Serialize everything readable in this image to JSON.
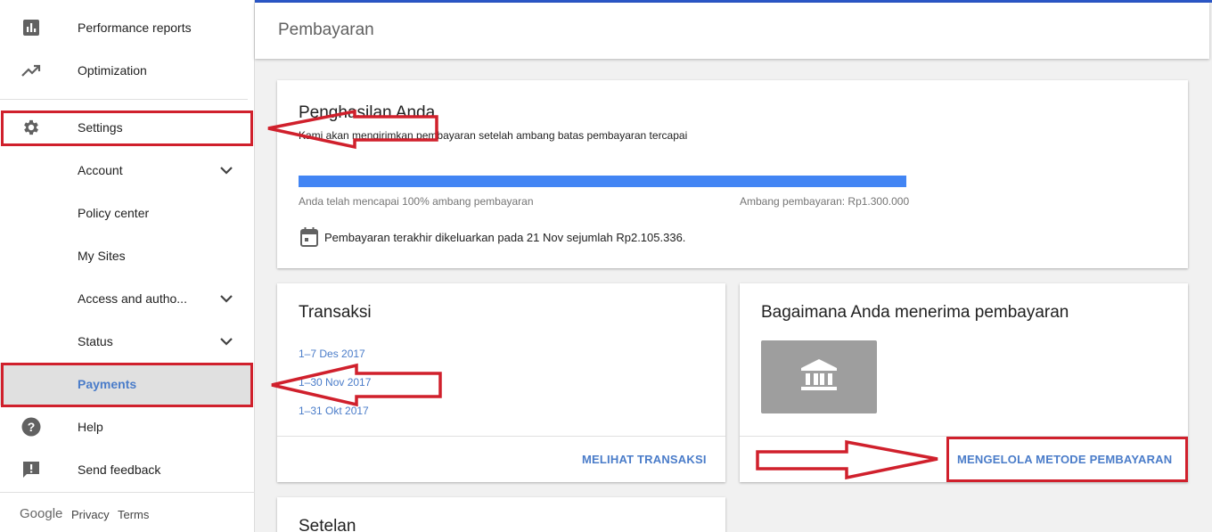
{
  "sidebar": {
    "items": [
      {
        "label": "Performance reports",
        "icon": "bar-chart-icon"
      },
      {
        "label": "Optimization",
        "icon": "trending-up-icon"
      },
      {
        "label": "Settings",
        "icon": "gear-icon"
      },
      {
        "label": "Account",
        "icon": "chevron-down-icon"
      },
      {
        "label": "Policy center"
      },
      {
        "label": "My Sites"
      },
      {
        "label": "Access and autho...",
        "icon": "chevron-down-icon"
      },
      {
        "label": "Status",
        "icon": "chevron-down-icon"
      },
      {
        "label": "Payments",
        "state": "selected"
      },
      {
        "label": "Help",
        "icon": "help-icon"
      },
      {
        "label": "Send feedback",
        "icon": "feedback-icon"
      }
    ],
    "footer": {
      "logo": "Google",
      "privacy": "Privacy",
      "terms": "Terms"
    }
  },
  "header": {
    "title": "Pembayaran"
  },
  "earnings": {
    "title": "Penghasilan Anda",
    "subtitle": "Kami akan mengirimkan pembayaran setelah ambang batas pembayaran tercapai",
    "progress_percent": 100,
    "progress_left": "Anda telah mencapai 100% ambang pembayaran",
    "progress_right": "Ambang pembayaran: Rp1.300.000",
    "last_payment": "Pembayaran terakhir dikeluarkan pada 21 Nov sejumlah Rp2.105.336.",
    "calendar_icon": "calendar-icon"
  },
  "transactions": {
    "title": "Transaksi",
    "periods": [
      "1–7 Des 2017",
      "1–30 Nov 2017",
      "1–31 Okt 2017"
    ],
    "action": "MELIHAT TRANSAKSI"
  },
  "payment_method": {
    "title": "Bagaimana Anda menerima pembayaran",
    "icon": "bank-icon",
    "action": "MENGELOLA METODE PEMBAYARAN"
  },
  "settings_card": {
    "title": "Setelan"
  },
  "colors": {
    "accent": "#4a7cc9",
    "progress": "#4285f4",
    "annotation": "#d0202c",
    "top_stripe": "#2a56c6"
  }
}
